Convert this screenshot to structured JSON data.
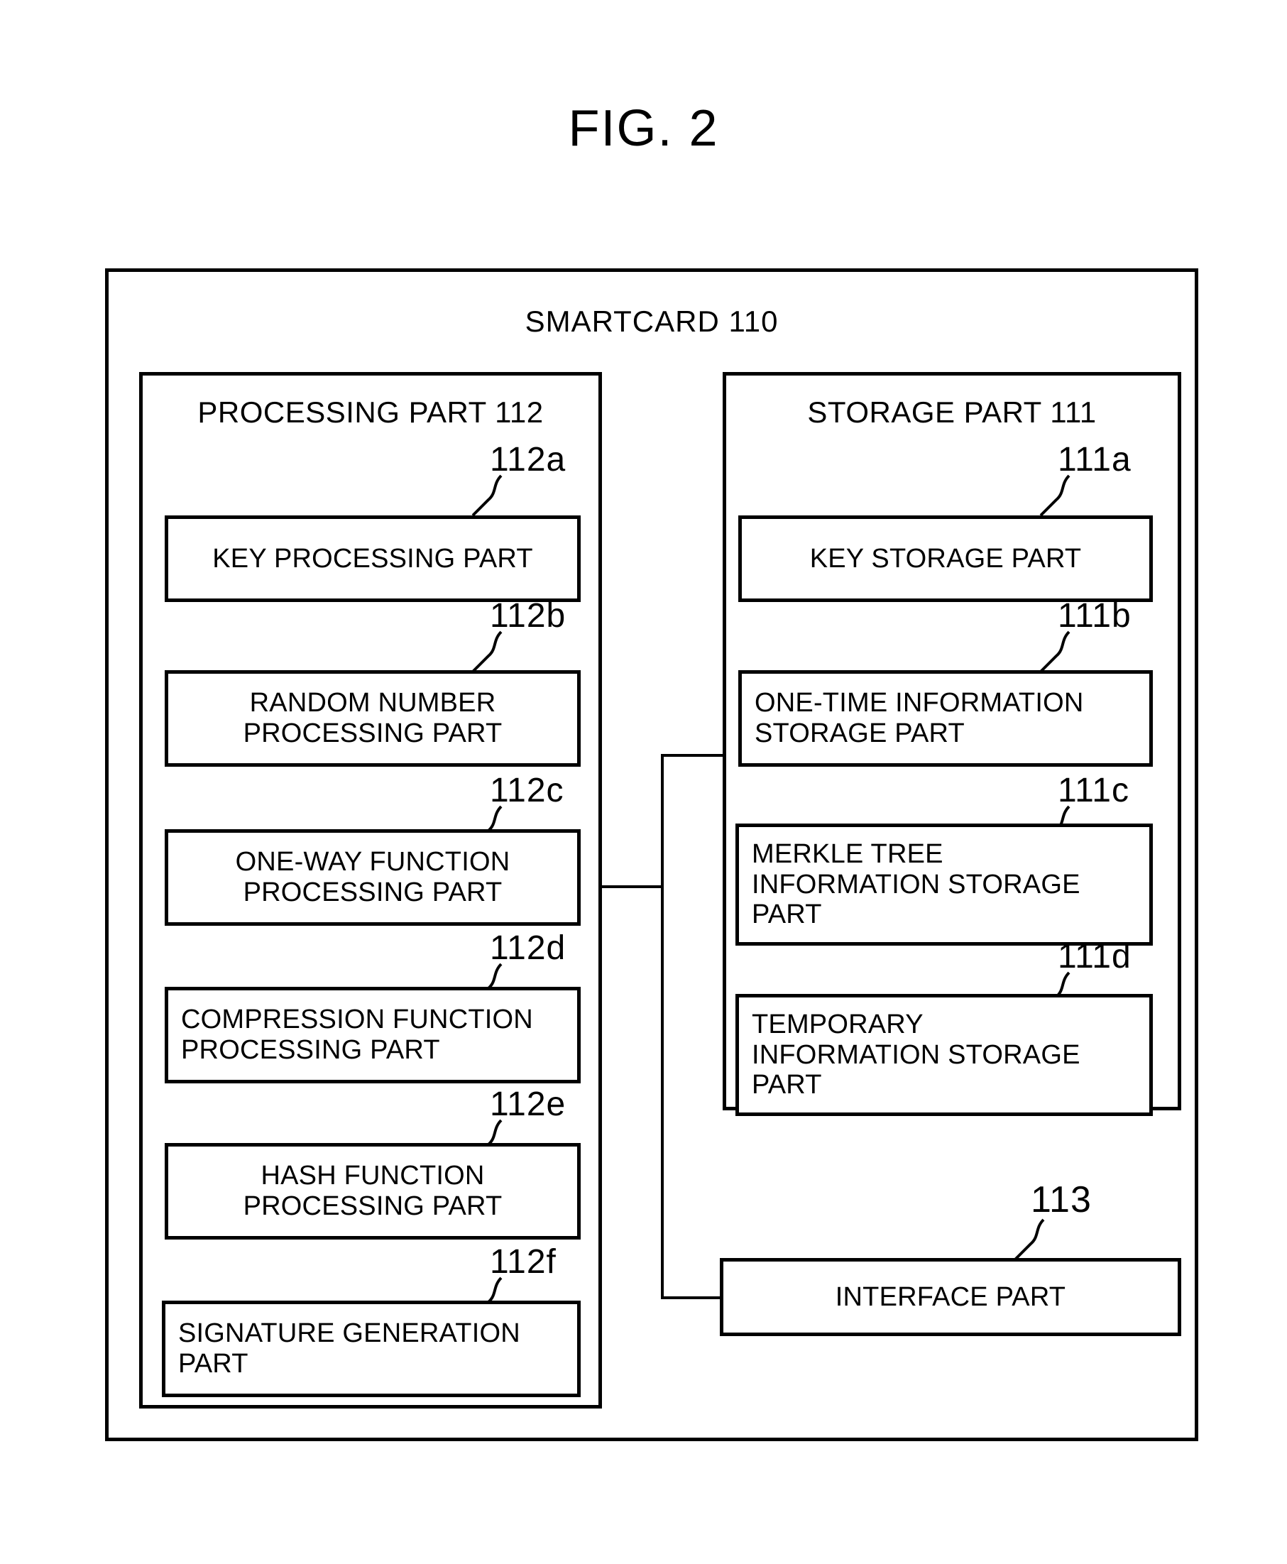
{
  "figure": {
    "title": "FIG. 2"
  },
  "outer": {
    "title": "SMARTCARD 110"
  },
  "panels": {
    "processing": {
      "title": "PROCESSING PART 112",
      "units": [
        {
          "ref": "112a",
          "label": "KEY PROCESSING PART",
          "align": "center"
        },
        {
          "ref": "112b",
          "label": "RANDOM NUMBER\nPROCESSING PART",
          "align": "center"
        },
        {
          "ref": "112c",
          "label": "ONE-WAY FUNCTION\nPROCESSING PART",
          "align": "center"
        },
        {
          "ref": "112d",
          "label": "COMPRESSION FUNCTION\nPROCESSING PART",
          "align": "left"
        },
        {
          "ref": "112e",
          "label": "HASH FUNCTION\nPROCESSING PART",
          "align": "center"
        },
        {
          "ref": "112f",
          "label": "SIGNATURE GENERATION\nPART",
          "align": "left"
        }
      ]
    },
    "storage": {
      "title": "STORAGE PART 111",
      "units": [
        {
          "ref": "111a",
          "label": "KEY STORAGE PART",
          "align": "center"
        },
        {
          "ref": "111b",
          "label": "ONE-TIME INFORMATION\nSTORAGE PART",
          "align": "left"
        },
        {
          "ref": "111c",
          "label": "MERKLE TREE\nINFORMATION STORAGE\nPART",
          "align": "left"
        },
        {
          "ref": "111d",
          "label": "TEMPORARY\nINFORMATION STORAGE\nPART",
          "align": "left"
        }
      ]
    }
  },
  "interface": {
    "ref": "113",
    "label": "INTERFACE PART"
  },
  "colors": {
    "line": "#000000",
    "background": "#ffffff"
  }
}
